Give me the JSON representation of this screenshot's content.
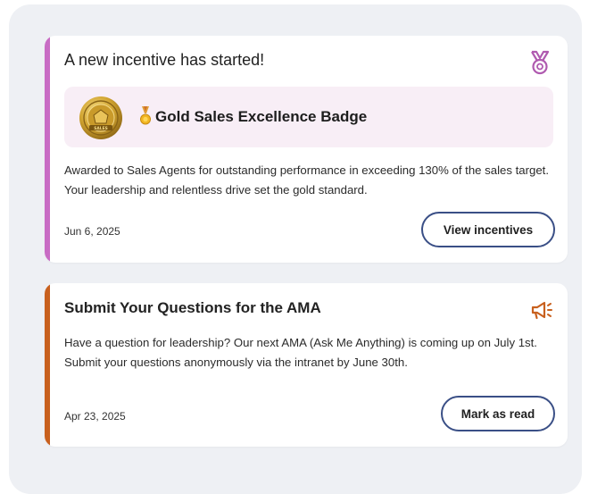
{
  "notifications": [
    {
      "title": "A new incentive has started!",
      "icon": "medal-ribbon-icon",
      "accent_color": "#c86cc4",
      "badge": {
        "name": "Gold Sales Excellence Badge",
        "medal_image_text": "GOLD SALES",
        "small_icon": "gold-medal-icon"
      },
      "body": "Awarded to Sales Agents for outstanding performance in exceeding 130% of the sales target. Your leadership and relentless drive set the gold standard.",
      "date": "Jun 6, 2025",
      "action_label": "View incentives"
    },
    {
      "title": "Submit Your Questions for the AMA",
      "icon": "megaphone-icon",
      "accent_color": "#c8601e",
      "body": "Have a question for leadership? Our next AMA (Ask Me Anything) is coming up on July 1st. Submit your questions anonymously via the intranet by June 30th.",
      "date": "Apr 23, 2025",
      "action_label": "Mark as read"
    }
  ]
}
